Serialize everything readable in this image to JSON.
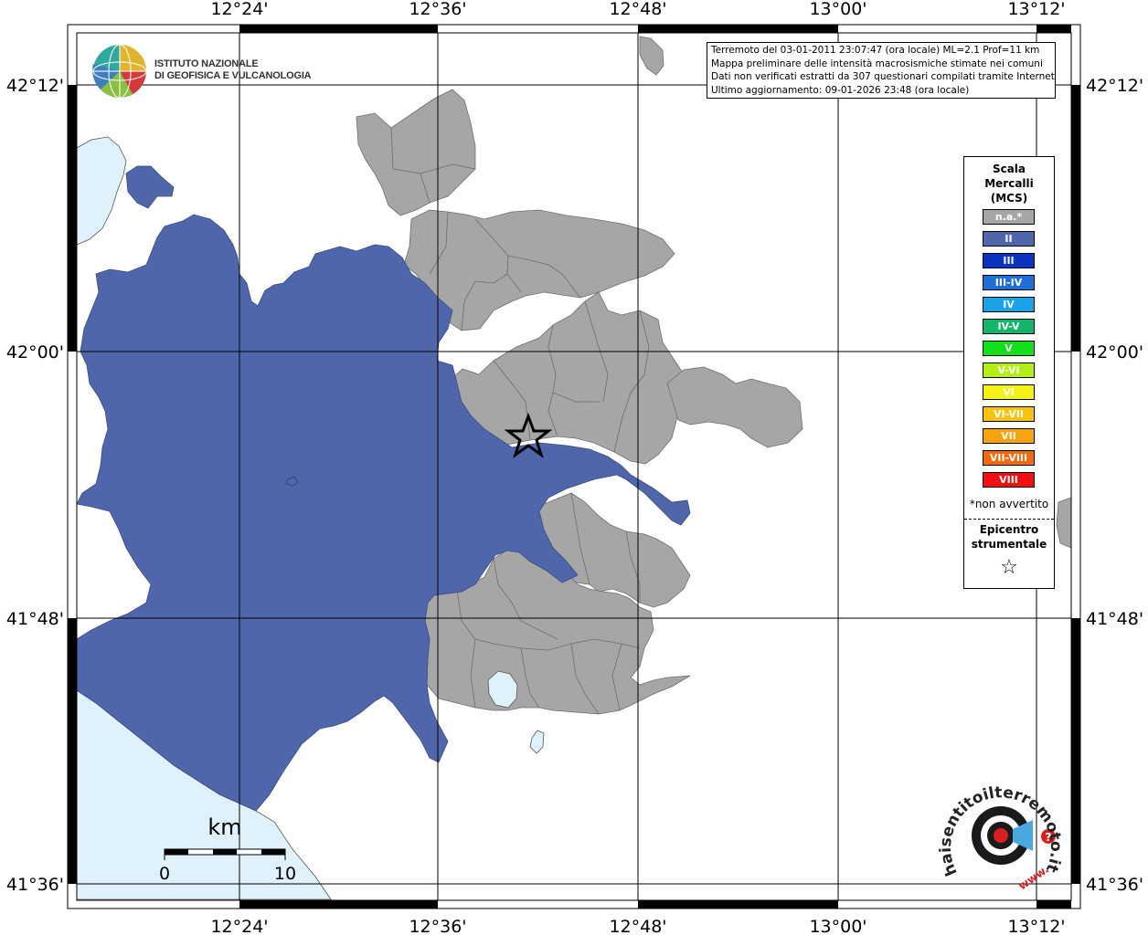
{
  "axes": {
    "top_ticks": [
      "12°24'",
      "12°36'",
      "12°48'",
      "13°00'",
      "13°12'"
    ],
    "bottom_ticks": [
      "12°24'",
      "12°36'",
      "12°48'",
      "13°00'",
      "13°12'"
    ],
    "left_ticks": [
      "42°12'",
      "42°00'",
      "41°48'",
      "41°36'"
    ],
    "right_ticks": [
      "42°12'",
      "42°00'",
      "41°48'",
      "41°36'"
    ]
  },
  "info": {
    "line1": "Terremoto del 03-01-2011 23:07:47 (ora locale) ML=2.1 Prof=11 km",
    "line2": "Mappa preliminare delle intensità macrosismiche stimate nei comuni",
    "line3": "Dati non verificati estratti da 307 questionari compilati tramite Internet.",
    "line4": "Ultimo aggiornamento: 09-01-2026 23:48 (ora locale)"
  },
  "logo": {
    "line1": "ISTITUTO NAZIONALE",
    "line2": "DI GEOFISICA E VULCANOLOGIA"
  },
  "legend": {
    "title1": "Scala",
    "title2": "Mercalli",
    "title3": "(MCS)",
    "items": [
      {
        "label": "n.a.*",
        "color": "#a6a6a6"
      },
      {
        "label": "II",
        "color": "#5066ab"
      },
      {
        "label": "III",
        "color": "#0a34c0"
      },
      {
        "label": "III-IV",
        "color": "#1e6fd8"
      },
      {
        "label": "IV",
        "color": "#1aa3e8"
      },
      {
        "label": "IV-V",
        "color": "#13b56a"
      },
      {
        "label": "V",
        "color": "#12e01a"
      },
      {
        "label": "V-VI",
        "color": "#b3ef16"
      },
      {
        "label": "VI",
        "color": "#f3f214"
      },
      {
        "label": "VI-VII",
        "color": "#f6c40e"
      },
      {
        "label": "VII",
        "color": "#f5a30e"
      },
      {
        "label": "VII-VIII",
        "color": "#f36a0c"
      },
      {
        "label": "VIII",
        "color": "#f01010"
      }
    ],
    "note": "*non avvertito",
    "epicentro1": "Epicentro",
    "epicentro2": "strumentale",
    "star": "☆"
  },
  "scale": {
    "unit": "km",
    "label_start": "0",
    "label_end": "10"
  },
  "haisentito": {
    "text": "haisentitoilterremoto.it",
    "prefix": "www.",
    "question": "?"
  },
  "colors": {
    "na": "#a6a6a6",
    "intensity_II": "#5066ab",
    "water": "#dff1fb"
  }
}
